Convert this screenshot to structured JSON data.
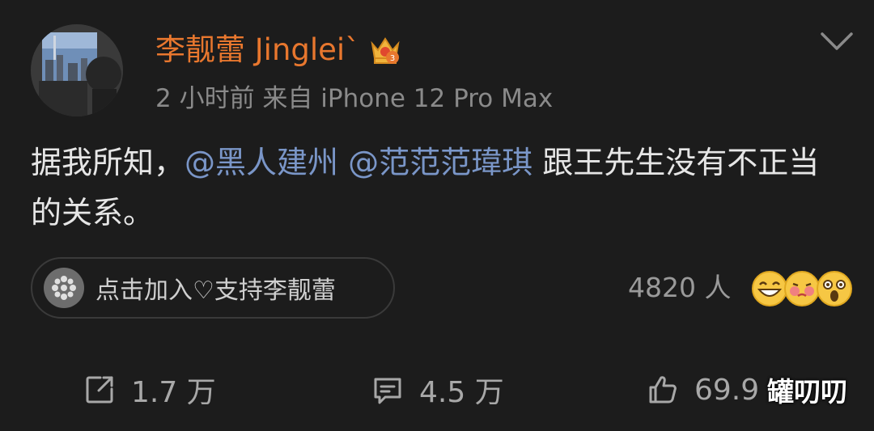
{
  "post": {
    "username": "李靓蕾 Jingleiˋ",
    "meta": "2 小时前   来自 iPhone 12 Pro Max",
    "content": {
      "text_before": "据我所知，",
      "mention_1": "@黑人建州",
      "mention_2": "@范范范瑋琪",
      "text_after": " 跟王先生没有不正当的关系。"
    },
    "support_label": "点击加入♡支持李靓蕾",
    "reaction_count": "4820 人",
    "actions": {
      "repost": "1.7 万",
      "comment": "4.5 万",
      "like": "69.9"
    },
    "watermark": "罐叨叨"
  },
  "icons": {
    "badge": "crown-badge-icon",
    "menu": "chevron-down-icon",
    "support": "flower-icon",
    "repost": "share-icon",
    "comment": "comment-icon",
    "like": "thumbs-up-icon"
  },
  "colors": {
    "username": "#e8772e",
    "mention": "#7a96c8",
    "badge": "#f0b43c"
  }
}
